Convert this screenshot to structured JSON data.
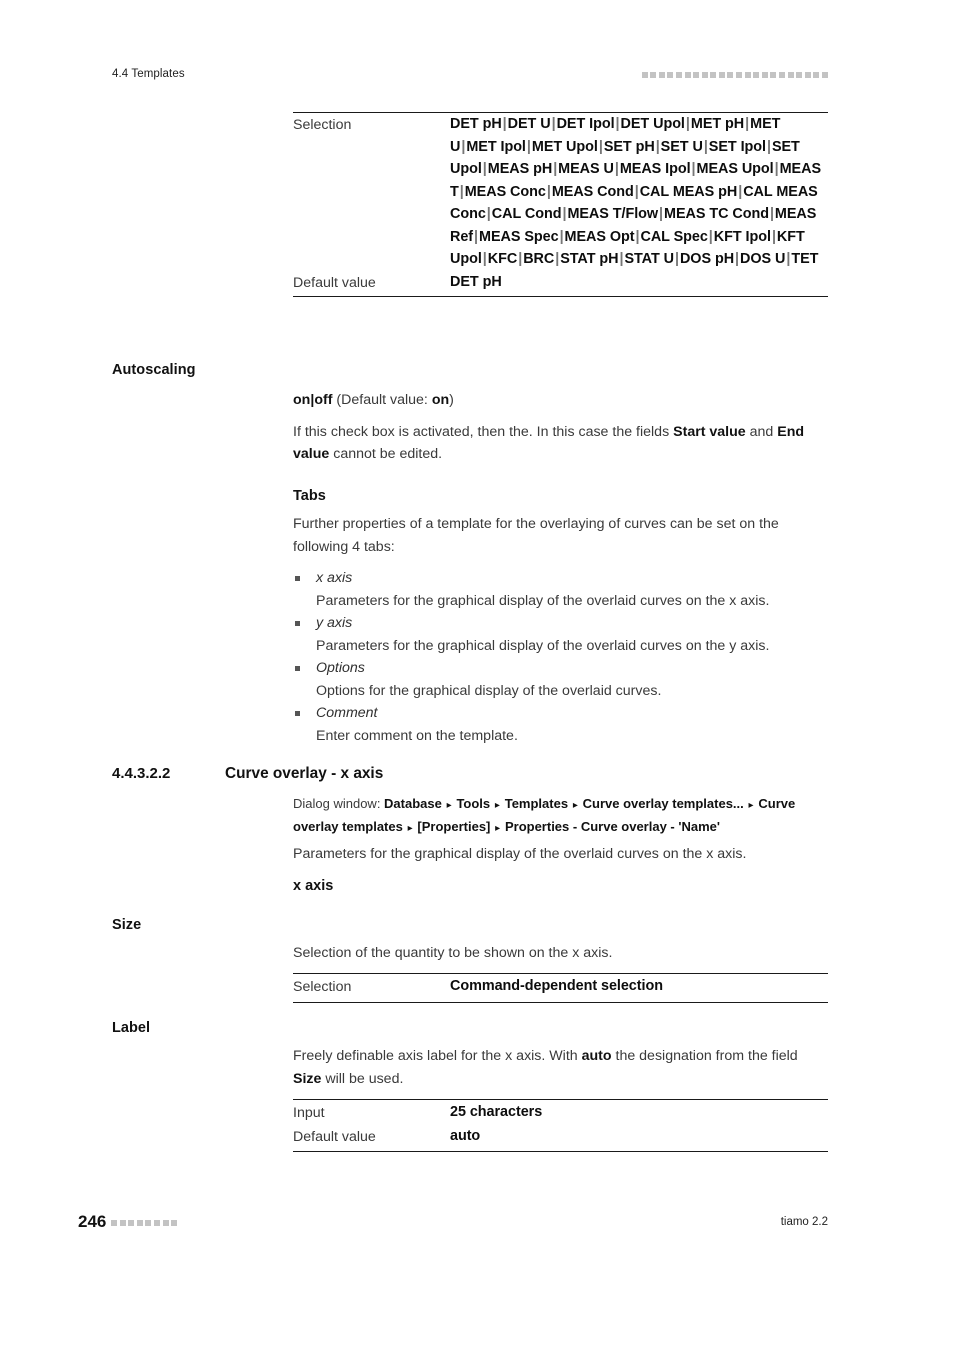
{
  "header": {
    "section_title": "4.4 Templates",
    "decor_squares": 22,
    "decor_color": "#c3c3c3"
  },
  "top_table": {
    "rows": [
      {
        "key": "Selection",
        "value": "DET pH | DET U | DET Ipol | DET Upol | MET pH | MET U | MET Ipol | MET Upol | SET pH | SET U | SET Ipol | SET Upol | MEAS pH | MEAS U | MEAS Ipol | MEAS Upol | MEAS T | MEAS Conc | MEAS Cond | CAL MEAS pH | CAL MEAS Conc | CAL Cond | MEAS T/Flow | MEAS TC Cond | MEAS Ref | MEAS Spec | MEAS Opt | CAL Spec | KFT Ipol | KFT Upol | KFC | BRC | STAT pH | STAT U | DOS pH | DOS U | TET",
        "options": [
          "DET pH",
          "DET U",
          "DET Ipol",
          "DET Upol",
          "MET pH",
          "MET U",
          "MET Ipol",
          "MET Upol",
          "SET pH",
          "SET U",
          "SET Ipol",
          "SET Upol",
          "MEAS pH",
          "MEAS U",
          "MEAS Ipol",
          "MEAS Upol",
          "MEAS T",
          "MEAS Conc",
          "MEAS Cond",
          "CAL MEAS pH",
          "CAL MEAS Conc",
          "CAL Cond",
          "MEAS T/Flow",
          "MEAS TC Cond",
          "MEAS Ref",
          "MEAS Spec",
          "MEAS Opt",
          "CAL Spec",
          "KFT Ipol",
          "KFT Upol",
          "KFC",
          "BRC",
          "STAT pH",
          "STAT U",
          "DOS pH",
          "DOS U",
          "TET"
        ]
      },
      {
        "key": "Default value",
        "value": "DET pH"
      }
    ]
  },
  "autoscaling": {
    "margin_label": "Autoscaling",
    "values_line_prefix": "on | off",
    "values_line_suffix": " (Default value: ",
    "default_value": "on",
    "values_line_end": ")",
    "description_part1": "If this check box is activated, then the. In this case the fields ",
    "description_bold1": "Start value",
    "description_part2": " and ",
    "description_bold2": "End value",
    "description_part3": " cannot be edited."
  },
  "tabs": {
    "heading": "Tabs",
    "intro": "Further properties of a template for the overlaying of curves can be set on the following 4 tabs:",
    "items": [
      {
        "term": "x axis",
        "desc": "Parameters for the graphical display of the overlaid curves on the x axis."
      },
      {
        "term": "y axis",
        "desc": "Parameters for the graphical display of the overlaid curves on the y axis."
      },
      {
        "term": "Options",
        "desc": "Options for the graphical display of the overlaid curves."
      },
      {
        "term": "Comment",
        "desc": "Enter comment on the template."
      }
    ]
  },
  "section": {
    "number": "4.4.3.2.2",
    "title": "Curve overlay - x axis",
    "breadcrumb_prefix": "Dialog window: ",
    "breadcrumb_items": [
      "Database",
      "Tools",
      "Templates",
      "Curve overlay templates...",
      "Curve overlay templates",
      "[Properties]",
      "Properties - Curve overlay - 'Name'"
    ],
    "breadcrumb_arrow": "▸",
    "intro": "Parameters for the graphical display of the overlaid curves on the x axis."
  },
  "x_axis_block": {
    "heading": "x axis"
  },
  "size_block": {
    "margin_label": "Size",
    "description": "Selection of the quantity to be shown on the x axis.",
    "table_rows": [
      {
        "key": "Selection",
        "value": "Command-dependent selection"
      }
    ]
  },
  "label_block": {
    "margin_label": "Label",
    "description_part1": "Freely definable axis label for the x axis. With ",
    "description_bold1": "auto",
    "description_part2": " the designation from the field ",
    "description_bold2": "Size",
    "description_part3": " will be used.",
    "table_rows": [
      {
        "key": "Input",
        "value": "25 characters"
      },
      {
        "key": "Default value",
        "value": "auto"
      }
    ]
  },
  "footer": {
    "page_number": "246",
    "decor_squares": 8,
    "product": "tiamo 2.2"
  }
}
